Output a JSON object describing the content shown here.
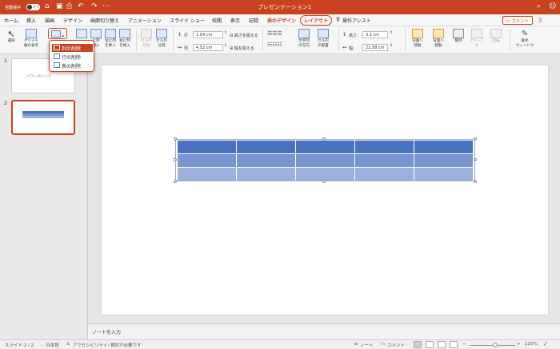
{
  "titlebar": {
    "autosave_label": "自動保存",
    "autosave_state": "オフ",
    "doc_title": "プレゼンテーション1",
    "icons": [
      "home-icon",
      "save-icon",
      "print-icon",
      "undo-icon",
      "redo-icon",
      "more-icon",
      "search-icon",
      "account-icon"
    ]
  },
  "menu": {
    "tabs": [
      "ホーム",
      "挿入",
      "描画",
      "デザイン",
      "画面切り替え",
      "アニメーション",
      "スライド ショー",
      "校閲",
      "表示",
      "記録",
      "表のデザイン",
      "レイアウト",
      "操作アシスト"
    ],
    "active_tab": "レイアウト",
    "comment_label": "コメント"
  },
  "ribbon": {
    "select": "選択",
    "gridlines_1": "グリッド",
    "gridlines_2": "線の表示",
    "insert_left_1": "左に列",
    "insert_left_2": "を挿入",
    "insert_right_1": "右に列",
    "insert_right_2": "を挿入",
    "insert_col_1": "に列",
    "insert_col_2": "挿入",
    "merge_1": "セルの",
    "merge_2": "結合",
    "split_1": "セルの",
    "split_2": "分割",
    "row_label": "行",
    "row_height": "1.04 cm",
    "col_label": "列",
    "col_width": "4.52 cm",
    "distribute_rows": "高さを揃える",
    "distribute_cols": "幅を揃える",
    "text_dir_1": "文字列",
    "text_dir_2": "の方向",
    "cell_margin_1": "セル内",
    "cell_margin_2": "の配置",
    "height_label": "高さ:",
    "height_value": "3.1 cm",
    "width_label": "幅:",
    "width_value": "22.58 cm",
    "bring_forward_1": "前面へ",
    "bring_forward_2": "移動",
    "send_backward_1": "背面へ",
    "send_backward_2": "移動",
    "align": "整列",
    "group_1": "グループ",
    "group_2": "化",
    "rotate": "回転",
    "format_pane_1": "書式",
    "format_pane_2": "ウィンドウ"
  },
  "delete_menu": {
    "items": [
      "列の削除",
      "行の削除",
      "表の削除"
    ],
    "selected": "列の削除"
  },
  "slides": {
    "numbers": [
      "1",
      "2"
    ],
    "slide1_caption": "パワーポイント",
    "selected": "2"
  },
  "notes_placeholder": "ノートを入力",
  "status": {
    "slide_counter": "スライド 2 / 2",
    "language": "日本語",
    "accessibility": "アクセシビリティ: 検討が必要です",
    "notes": "ノート",
    "comments": "コメント",
    "zoom": "120%"
  },
  "colors": {
    "accent": "#c8431f",
    "table_header": "#4a72c4",
    "table_band1": "#7a94cf",
    "table_band2": "#9bb0dc"
  }
}
